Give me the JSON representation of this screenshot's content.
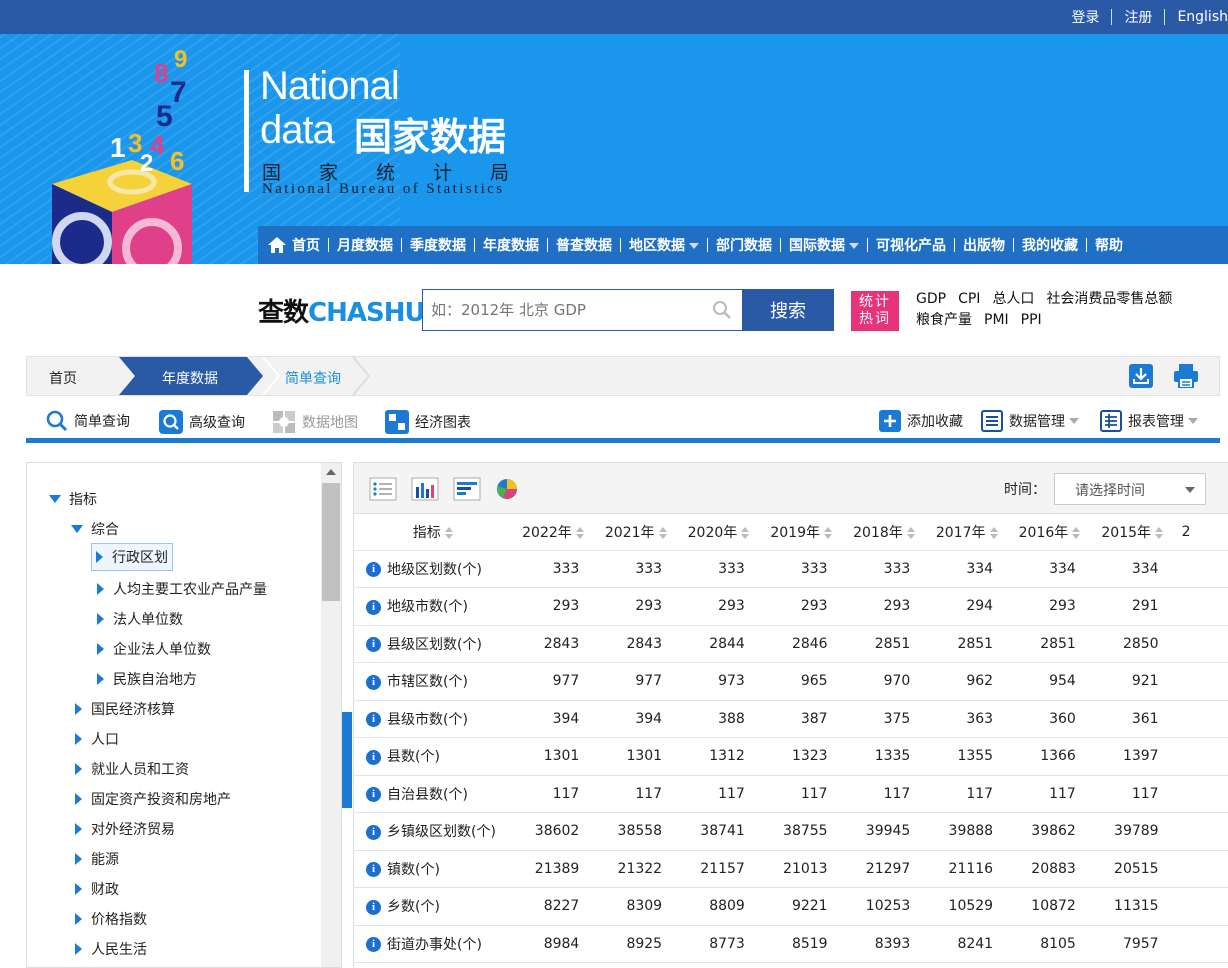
{
  "topbar": {
    "login": "登录",
    "register": "注册",
    "english": "English"
  },
  "logo": {
    "en_line1": "National",
    "en_line2": "data",
    "cn_title": "国家数据",
    "bureau_cn": "国家统计局",
    "bureau_en": "National Bureau of Statistics",
    "cube_digits": [
      "1",
      "3",
      "4",
      "2",
      "6",
      "5",
      "7",
      "8",
      "9"
    ]
  },
  "nav": {
    "items": [
      {
        "label": "首页"
      },
      {
        "label": "月度数据"
      },
      {
        "label": "季度数据"
      },
      {
        "label": "年度数据"
      },
      {
        "label": "普查数据"
      },
      {
        "label": "地区数据"
      },
      {
        "label": "部门数据"
      },
      {
        "label": "国际数据"
      },
      {
        "label": "可视化产品"
      },
      {
        "label": "出版物"
      },
      {
        "label": "我的收藏"
      },
      {
        "label": "帮助"
      }
    ]
  },
  "search": {
    "logo_a": "查数",
    "logo_b": "CHASHU",
    "placeholder": "如：2012年 北京 GDP",
    "button": "搜索",
    "hot_line1": "统计",
    "hot_line2": "热词",
    "hot_words_row1": [
      "GDP",
      "CPI",
      "总人口",
      "社会消费品零售总额"
    ],
    "hot_words_row2": [
      "粮食产量",
      "PMI",
      "PPI"
    ]
  },
  "breadcrumb": {
    "home": "首页",
    "annual": "年度数据",
    "simple": "简单查询"
  },
  "tools": {
    "simple_query": "简单查询",
    "advanced_query": "高级查询",
    "data_map": "数据地图",
    "econ_chart": "经济图表",
    "add_favorite": "添加收藏",
    "data_manage": "数据管理",
    "report_manage": "报表管理"
  },
  "tree": {
    "root": "指标",
    "group": "综合",
    "children": [
      "行政区划",
      "人均主要工农业产品产量",
      "法人单位数",
      "企业法人单位数",
      "民族自治地方"
    ],
    "categories": [
      "国民经济核算",
      "人口",
      "就业人员和工资",
      "固定资产投资和房地产",
      "对外经济贸易",
      "能源",
      "财政",
      "价格指数",
      "人民生活"
    ]
  },
  "table": {
    "time_label": "时间：",
    "time_placeholder": "请选择时间",
    "indicator_header": "指标",
    "years": [
      "2022年",
      "2021年",
      "2020年",
      "2019年",
      "2018年",
      "2017年",
      "2016年",
      "2015年",
      "2"
    ],
    "rows": [
      {
        "name": "地级区划数(个)",
        "values": [
          "333",
          "333",
          "333",
          "333",
          "333",
          "334",
          "334",
          "334"
        ]
      },
      {
        "name": "地级市数(个)",
        "values": [
          "293",
          "293",
          "293",
          "293",
          "293",
          "294",
          "293",
          "291"
        ]
      },
      {
        "name": "县级区划数(个)",
        "values": [
          "2843",
          "2843",
          "2844",
          "2846",
          "2851",
          "2851",
          "2851",
          "2850"
        ]
      },
      {
        "name": "市辖区数(个)",
        "values": [
          "977",
          "977",
          "973",
          "965",
          "970",
          "962",
          "954",
          "921"
        ]
      },
      {
        "name": "县级市数(个)",
        "values": [
          "394",
          "394",
          "388",
          "387",
          "375",
          "363",
          "360",
          "361"
        ]
      },
      {
        "name": "县数(个)",
        "values": [
          "1301",
          "1301",
          "1312",
          "1323",
          "1335",
          "1355",
          "1366",
          "1397"
        ]
      },
      {
        "name": "自治县数(个)",
        "values": [
          "117",
          "117",
          "117",
          "117",
          "117",
          "117",
          "117",
          "117"
        ]
      },
      {
        "name": "乡镇级区划数(个)",
        "values": [
          "38602",
          "38558",
          "38741",
          "38755",
          "39945",
          "39888",
          "39862",
          "39789"
        ]
      },
      {
        "name": "镇数(个)",
        "values": [
          "21389",
          "21322",
          "21157",
          "21013",
          "21297",
          "21116",
          "20883",
          "20515"
        ]
      },
      {
        "name": "乡数(个)",
        "values": [
          "8227",
          "8309",
          "8809",
          "9221",
          "10253",
          "10529",
          "10872",
          "11315"
        ]
      },
      {
        "name": "街道办事处(个)",
        "values": [
          "8984",
          "8925",
          "8773",
          "8519",
          "8393",
          "8241",
          "8105",
          "7957"
        ]
      }
    ]
  },
  "colors": {
    "topbar": "#2a5aa6",
    "banner": "#1a96ec",
    "nav": "#1f6fc5",
    "accent": "#1a7ad4",
    "hot": "#e6337a"
  }
}
